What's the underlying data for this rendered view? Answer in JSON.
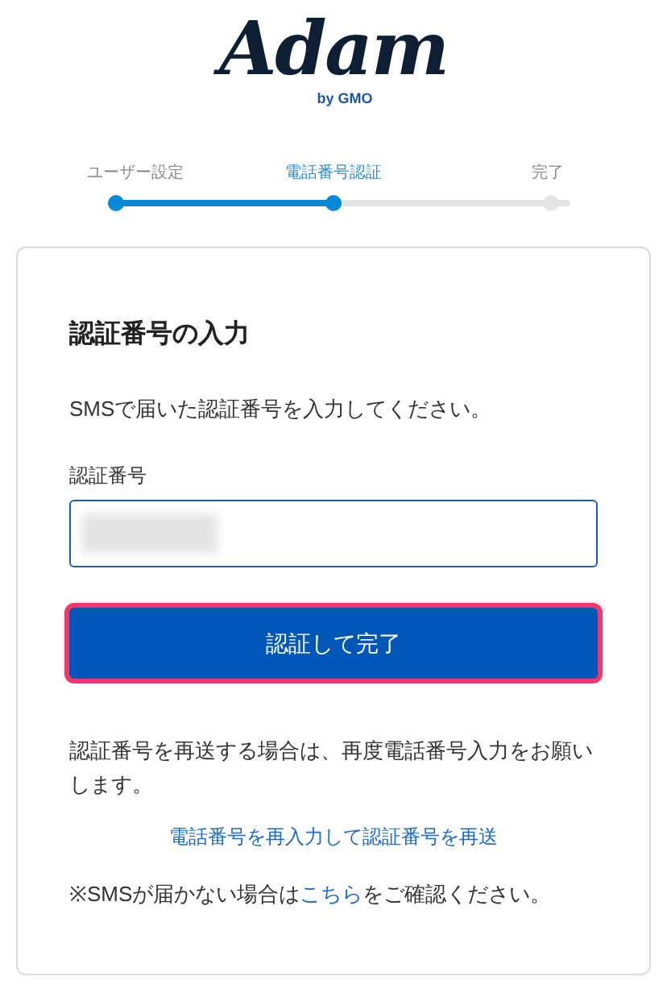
{
  "logo": {
    "name": "Adam",
    "byline": "by GMO"
  },
  "steps": [
    {
      "label": "ユーザー設定",
      "done": true,
      "selected": false
    },
    {
      "label": "電話番号認証",
      "done": true,
      "selected": true
    },
    {
      "label": "完了",
      "done": false,
      "selected": false
    }
  ],
  "card": {
    "title": "認証番号の入力",
    "instruction": "SMSで届いた認証番号を入力してください。",
    "field": {
      "label": "認証番号",
      "redacted": true
    },
    "button": {
      "label": "認証して完了",
      "highlighted": true
    },
    "resend_note": "認証番号を再送する場合は、再度電話番号入力をお願いします。",
    "resend_link": "電話番号を再入力して認証番号を再送",
    "help": {
      "before": "※SMSが届かない場合は",
      "link": "こちら",
      "after": "をご確認ください。"
    }
  }
}
